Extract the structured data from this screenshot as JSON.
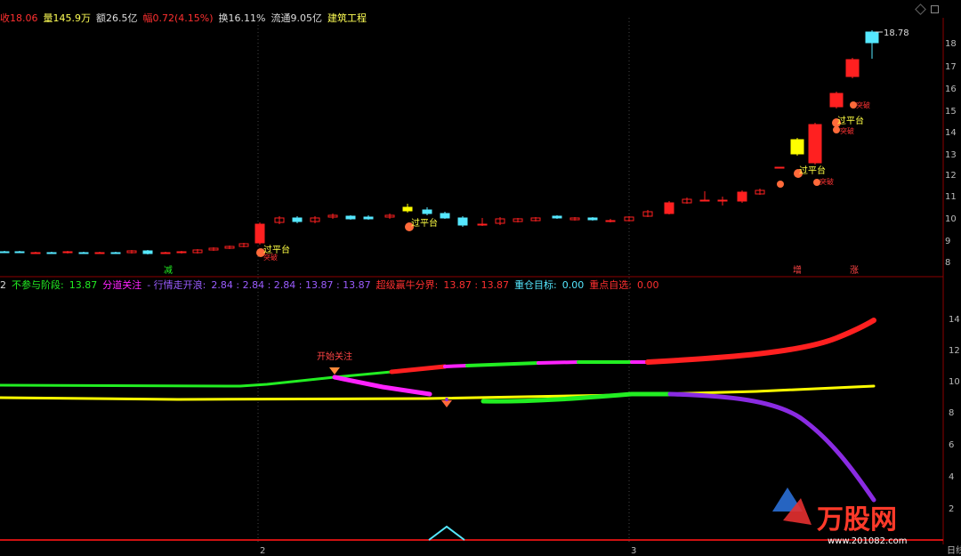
{
  "header": {
    "close_label": "收18.06",
    "volume_label": "量145.9万",
    "amount_label": "额26.5亿",
    "change_label": "幅0.72(4.15%)",
    "turnover_label": "换16.11%",
    "float_label": "流通9.05亿",
    "sector_label": "建筑工程"
  },
  "price_panel": {
    "high_label": "18.78",
    "y_ticks": [
      "18",
      "17",
      "16",
      "15",
      "14",
      "13",
      "12",
      "11",
      "10",
      "9",
      "8"
    ],
    "markers": {
      "ping_tai_1": "过平台",
      "ping_tai_2": "过平台",
      "ping_tai_3": "过平台",
      "ping_tai_4": "过平台",
      "po_1": "突破",
      "po_2": "突破",
      "po_3": "突破",
      "po_4": "突破",
      "bottom_tag_1": "减",
      "bottom_tag_2": "增",
      "bottom_tag_3": "涨"
    }
  },
  "indicator_bar": {
    "prefix": "2",
    "item1_label": "不参与阶段:",
    "item1_value": "13.87",
    "item2_label": "分道关注",
    "item3_label": "- 行情走开浪:",
    "item3_values": "2.84 : 2.84 : 2.84 : 13.87 : 13.87",
    "item4_label": "超级赢牛分界:",
    "item4_values": "13.87 : 13.87",
    "item5_label": "重仓目标:",
    "item5_value": "0.00",
    "item6_label": "重点自选:",
    "item6_value": "0.00"
  },
  "indicator_panel": {
    "annotation": "开始关注",
    "y_ticks": [
      "14",
      "12",
      "10",
      "8",
      "6",
      "4",
      "2"
    ]
  },
  "bottom_axis": {
    "ticks": [
      "2",
      "3"
    ],
    "corner": "日线"
  },
  "watermark": {
    "brand": "万股网",
    "url": "www.201082.com"
  },
  "colors": {
    "up": "#ff2020",
    "down": "#55e8ff",
    "yellow": "#ffff00",
    "green": "#22ee22",
    "magenta": "#ff22ff",
    "purple": "#8a2be2",
    "gridline": "#8b0000"
  }
}
